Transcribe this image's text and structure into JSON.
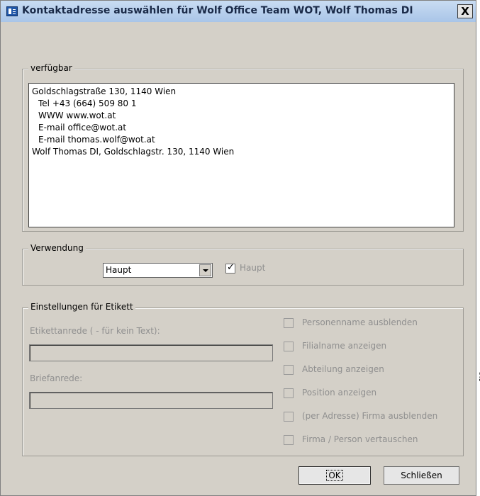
{
  "window": {
    "title": "Kontaktadresse auswählen für Wolf Office Team WOT, Wolf Thomas DI",
    "close_label": "X"
  },
  "available": {
    "legend": "verfügbar",
    "items": [
      {
        "text": "Goldschlagstraße 130, 1140 Wien",
        "indent": false
      },
      {
        "text": "Tel +43 (664) 509 80 1",
        "indent": true
      },
      {
        "text": "WWW www.wot.at",
        "indent": true
      },
      {
        "text": "E-mail office@wot.at",
        "indent": true
      },
      {
        "text": "E-mail thomas.wolf@wot.at",
        "indent": true
      },
      {
        "text": "Wolf Thomas DI, Goldschlagstr. 130, 1140 Wien",
        "indent": false
      }
    ]
  },
  "usage": {
    "legend": "Verwendung",
    "select_value": "Haupt",
    "checkbox_label": "Haupt",
    "checkbox_checked": true
  },
  "label_settings": {
    "legend": "Einstellungen für Etikett",
    "salutation_label": "Etikettanrede ( - für kein Text):",
    "salutation_value": "",
    "letter_salutation_label": "Briefanrede:",
    "letter_salutation_value": "",
    "options": [
      {
        "label": "Personenname ausblenden",
        "checked": false
      },
      {
        "label": "Filialname anzeigen",
        "checked": false
      },
      {
        "label": "Abteilung anzeigen",
        "checked": false
      },
      {
        "label": "Position anzeigen",
        "checked": false
      },
      {
        "label": "(per Adresse) Firma ausblenden",
        "checked": false
      },
      {
        "label": "Firma / Person vertauschen",
        "checked": false
      }
    ]
  },
  "buttons": {
    "ok": "OK",
    "close": "Schließen"
  },
  "background_fragment": "g",
  "colors": {
    "dialog_bg": "#d4d0c8",
    "titlebar": "#b6cfee",
    "disabled_text": "#8f8f8f"
  }
}
